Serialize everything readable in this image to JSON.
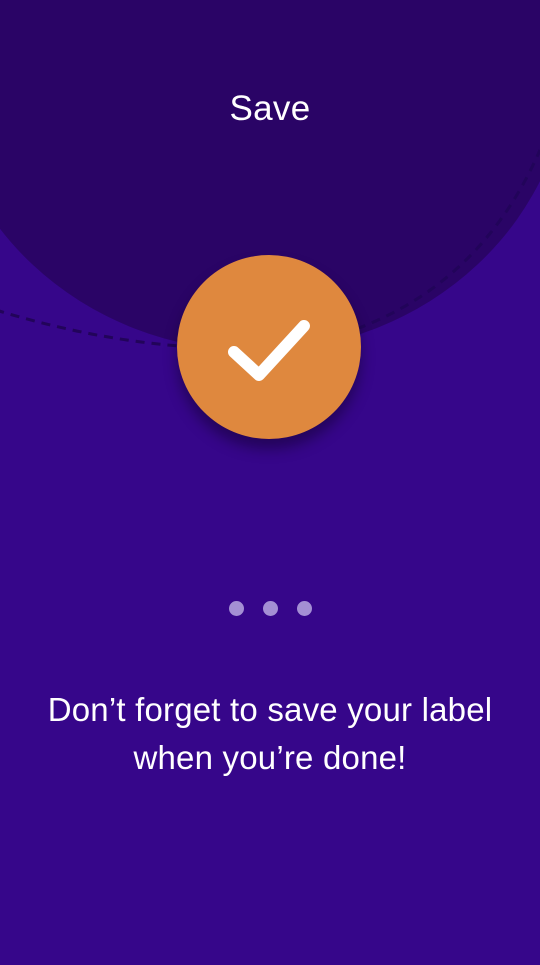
{
  "screen": {
    "title": "Save",
    "message_lines": [
      "Don’t forget to save your label",
      "when you’re done!"
    ]
  },
  "pager": {
    "pages": 3
  },
  "icons": {
    "badge": "checkmark-icon"
  },
  "colors": {
    "background": "#36068a",
    "background_shape": "#2a0466",
    "badge": "#df883e",
    "checkmark": "#ffffff",
    "pager_dot": "#a48fd4",
    "text": "#ffffff"
  }
}
